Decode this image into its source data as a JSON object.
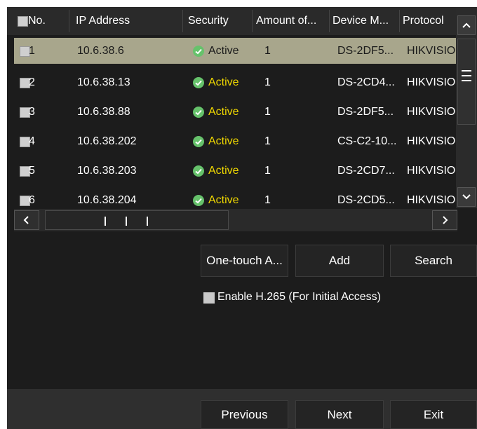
{
  "table": {
    "headers": {
      "no": "No.",
      "ip": "IP Address",
      "security": "Security",
      "amount": "Amount of...",
      "model": "Device M...",
      "protocol": "Protocol"
    },
    "rows": [
      {
        "no": "1",
        "ip": "10.6.38.6",
        "security": "Active",
        "amount": "1",
        "model": "DS-2DF5...",
        "protocol": "HIKVISIO"
      },
      {
        "no": "2",
        "ip": "10.6.38.13",
        "security": "Active",
        "amount": "1",
        "model": "DS-2CD4...",
        "protocol": "HIKVISIO"
      },
      {
        "no": "3",
        "ip": "10.6.38.88",
        "security": "Active",
        "amount": "1",
        "model": "DS-2DF5...",
        "protocol": "HIKVISIO"
      },
      {
        "no": "4",
        "ip": "10.6.38.202",
        "security": "Active",
        "amount": "1",
        "model": "CS-C2-10...",
        "protocol": "HIKVISIO"
      },
      {
        "no": "5",
        "ip": "10.6.38.203",
        "security": "Active",
        "amount": "1",
        "model": "DS-2CD7...",
        "protocol": "HIKVISIO"
      },
      {
        "no": "6",
        "ip": "10.6.38.204",
        "security": "Active",
        "amount": "1",
        "model": "DS-2CD5...",
        "protocol": "HIKVISIO"
      }
    ],
    "selected_row": 1
  },
  "scroll": {
    "up_icon": "chevron-up-icon",
    "down_icon": "chevron-down-icon",
    "left_icon": "chevron-left-icon",
    "right_icon": "chevron-right-icon"
  },
  "actions": {
    "one_touch": "One-touch A...",
    "add": "Add",
    "search": "Search"
  },
  "h265": {
    "label": "Enable H.265 (For Initial Access)",
    "checked": false
  },
  "footer": {
    "previous": "Previous",
    "next": "Next",
    "exit": "Exit"
  },
  "colors": {
    "panel_bg": "#1c1c1c",
    "selected_row_bg": "#a8a68c",
    "active_text": "#f0d800",
    "status_ok": "#66c26b"
  }
}
